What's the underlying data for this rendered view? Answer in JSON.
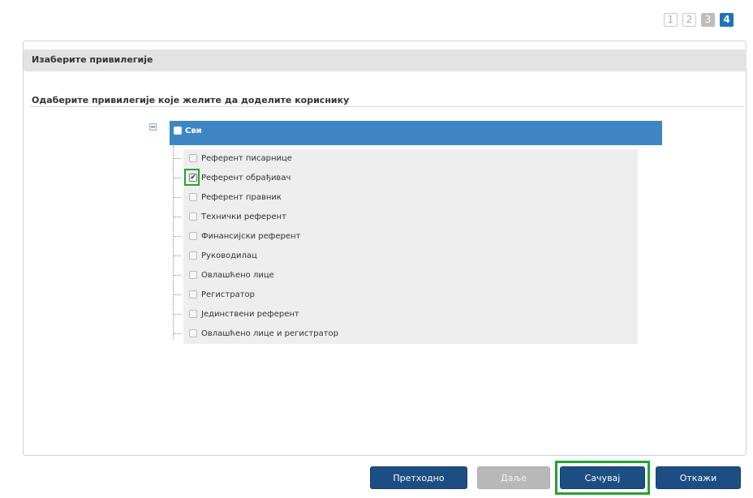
{
  "steps": [
    "1",
    "2",
    "3",
    "4"
  ],
  "panel": {
    "title": "Изаберите привилегије",
    "subheading": "Одаберите привилегије које желите да доделите кориснику"
  },
  "tree": {
    "root_label": "Сви",
    "items": [
      {
        "label": "Референт писарнице",
        "checked": false
      },
      {
        "label": "Референт обрађивач",
        "checked": true
      },
      {
        "label": "Референт правник",
        "checked": false
      },
      {
        "label": "Технички референт",
        "checked": false
      },
      {
        "label": "Финансијски референт",
        "checked": false
      },
      {
        "label": "Руководилац",
        "checked": false
      },
      {
        "label": "Овлашћено лице",
        "checked": false
      },
      {
        "label": "Регистратор",
        "checked": false
      },
      {
        "label": "Јединствени референт",
        "checked": false
      },
      {
        "label": "Овлашћено лице и регистратор",
        "checked": false
      }
    ]
  },
  "buttons": {
    "previous": "Претходно",
    "next": "Даље",
    "save": "Сачувај",
    "cancel": "Откажи"
  },
  "colors": {
    "accent": "#1c74bb",
    "tree_header": "#3e85c6",
    "button_primary": "#1d4e83",
    "highlight": "#2aa232"
  }
}
